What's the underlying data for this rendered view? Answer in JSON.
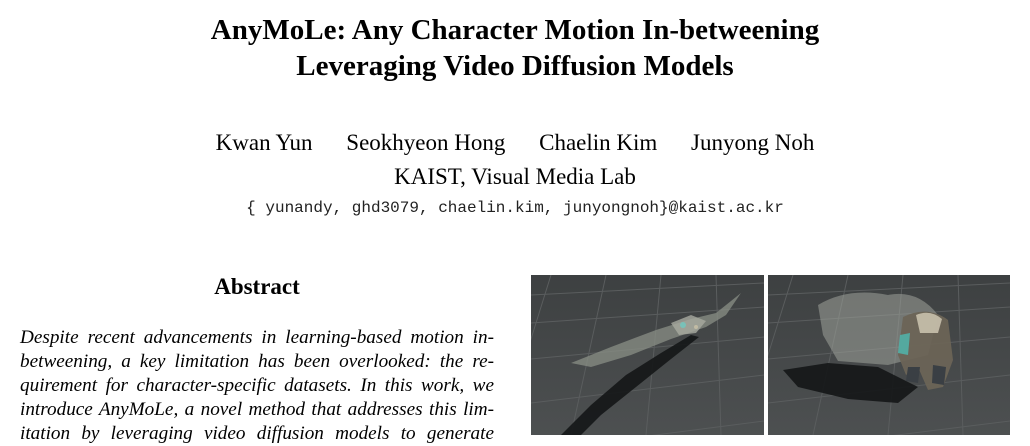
{
  "paper": {
    "title_line1": "AnyMoLe: Any Character Motion In-betweening",
    "title_line2": "Leveraging Video Diffusion Models",
    "authors": [
      "Kwan Yun",
      "Seokhyeon Hong",
      "Chaelin Kim",
      "Junyong Noh"
    ],
    "affiliation": "KAIST, Visual Media Lab",
    "email": "{ yunandy, ghd3079, chaelin.kim, junyongnoh}@kaist.ac.kr",
    "abstract_heading": "Abstract",
    "abstract_lines": [
      "Despite recent advancements in learning-based motion in-",
      "betweening, a key limitation has been overlooked:  the re-",
      "quirement for character-specific datasets.  In this work, we",
      "introduce AnyMoLe, a novel method that addresses this lim-",
      "itation by leveraging video diffusion models to generate"
    ]
  },
  "figures": {
    "left_label": "rendered-character-frame-1",
    "right_label": "rendered-character-frame-2",
    "floor_color": "#454849",
    "grid_color": "#5a5d5e"
  }
}
